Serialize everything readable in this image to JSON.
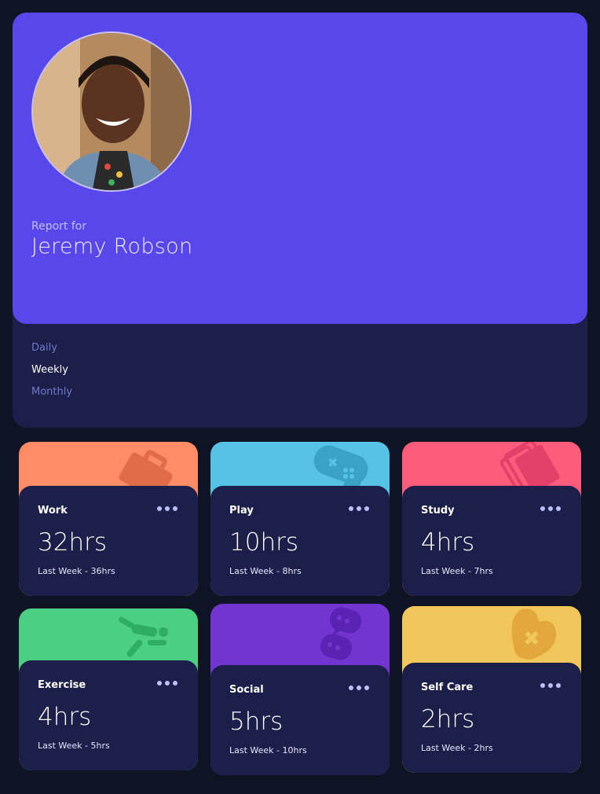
{
  "profile": {
    "report_label": "Report for",
    "name": "Jeremy Robson"
  },
  "tabs": [
    {
      "label": "Daily",
      "active": false
    },
    {
      "label": "Weekly",
      "active": true
    },
    {
      "label": "Monthly",
      "active": false
    }
  ],
  "activities": [
    {
      "title": "Work",
      "hours": "32hrs",
      "previous": "Last Week - 36hrs",
      "color": "#ff8c66",
      "icon": "briefcase-icon"
    },
    {
      "title": "Play",
      "hours": "10hrs",
      "previous": "Last Week - 8hrs",
      "color": "#56c2e6",
      "icon": "gamepad-icon"
    },
    {
      "title": "Study",
      "hours": "4hrs",
      "previous": "Last Week - 7hrs",
      "color": "#ff5c7c",
      "icon": "books-icon"
    },
    {
      "title": "Exercise",
      "hours": "4hrs",
      "previous": "Last Week - 5hrs",
      "color": "#4bcf82",
      "icon": "running-icon"
    },
    {
      "title": "Social",
      "hours": "5hrs",
      "previous": "Last Week - 10hrs",
      "color": "#7335d2",
      "icon": "chat-icon"
    },
    {
      "title": "Self Care",
      "hours": "2hrs",
      "previous": "Last Week - 2hrs",
      "color": "#f1c75b",
      "icon": "heart-icon"
    }
  ]
}
